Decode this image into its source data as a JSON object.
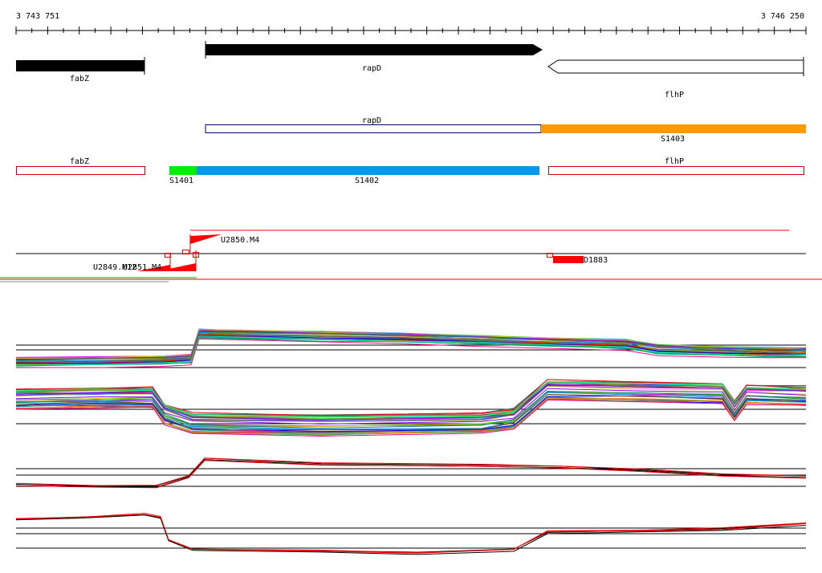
{
  "ruler": {
    "start_label": "3 743 751",
    "end_label": "3 746 250"
  },
  "colors": {
    "gene_fill": "#000000",
    "annotation_outline_blue": "#000080",
    "annotation_outline_red": "#cc0000",
    "segment_orange": "#ff9900",
    "segment_green": "#00ee00",
    "segment_blue": "#0099ee",
    "signal_red": "#ff0000"
  },
  "genes": [
    {
      "label": "fabZ",
      "strand": "+",
      "style": "filled"
    },
    {
      "label": "rapD",
      "strand": "+",
      "style": "filled"
    },
    {
      "label": "flhP",
      "strand": "-",
      "style": "outline"
    }
  ],
  "annotations": [
    {
      "label": "rapD",
      "style": "outline-blue"
    },
    {
      "label": "S1403",
      "style": "filled-orange"
    },
    {
      "label": "fabZ",
      "style": "outline-red"
    },
    {
      "label": "S1401",
      "style": "filled-green"
    },
    {
      "label": "S1402",
      "style": "filled-blue"
    },
    {
      "label": "flhP",
      "style": "outline-red"
    }
  ],
  "signals": [
    {
      "label": "U2850.M4"
    },
    {
      "label": "U2849.M12"
    },
    {
      "label": "U2851.M4"
    },
    {
      "label": "D1883"
    }
  ]
}
